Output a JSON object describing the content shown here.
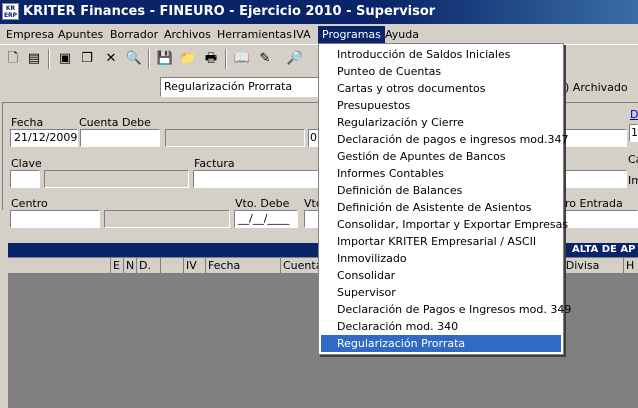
{
  "window": {
    "logo_text": "KR ERP",
    "title": "KRITER Finances - FINEURO - Ejercicio 2010 - Supervisor"
  },
  "menubar": {
    "items": [
      "Empresa",
      "Apuntes",
      "Borrador",
      "Archivos",
      "Herramientas",
      "IVA",
      "Programas",
      "Ayuda"
    ],
    "active": "Programas"
  },
  "toolbar": {
    "icons": [
      "new-document-icon",
      "notes-icon",
      "save-icon",
      "copy-icon",
      "delete-icon",
      "print-preview-icon",
      "save-disk-icon",
      "folder-icon",
      "printer-icon",
      "book-icon",
      "edit-icon",
      "search-icon"
    ]
  },
  "form": {
    "search_value": "Regularización Prorrata",
    "archivado_label": ") Archivado",
    "fecha_label": "Fecha",
    "fecha_value": "21/12/2009",
    "cuenta_debe_label": "Cuenta Debe",
    "amount_prefix": "0,",
    "clave_label": "Clave",
    "factura_label": "Factura",
    "centro_label": "Centro",
    "vto_debe_label": "Vto. Debe",
    "vto_debe_value": "__/__/____",
    "vto_label": "Vto",
    "entrada_label": "ro  Entrada",
    "right_d": "D",
    "right_1": "1",
    "right_ca": "Ca",
    "right_im": "Im"
  },
  "grid": {
    "header_right": "ALTA DE AP",
    "columns": [
      "",
      "E",
      "N",
      "D.",
      "",
      "IV",
      "Fecha",
      "Cuenta"
    ],
    "right_column": ").Divisa",
    "right_col_h": "H"
  },
  "dropdown": {
    "items": [
      "Introducción de Saldos Iniciales",
      "Punteo de Cuentas",
      "Cartas y otros documentos",
      "Presupuestos",
      "Regularización y Cierre",
      "Declaración de pagos e ingresos mod.347",
      "Gestión de Apuntes de Bancos",
      "Informes Contables",
      "Definición de Balances",
      "Definición de Asistente de Asientos",
      "Consolidar, Importar y Exportar Empresas",
      "Importar KRITER Empresarial / ASCII",
      "Inmovilizado",
      "Consolidar",
      "Supervisor",
      "Declaración de Pagos e Ingresos mod. 349",
      "Declaración mod. 340",
      "Regularización Prorrata"
    ],
    "selected": "Regularización Prorrata"
  }
}
